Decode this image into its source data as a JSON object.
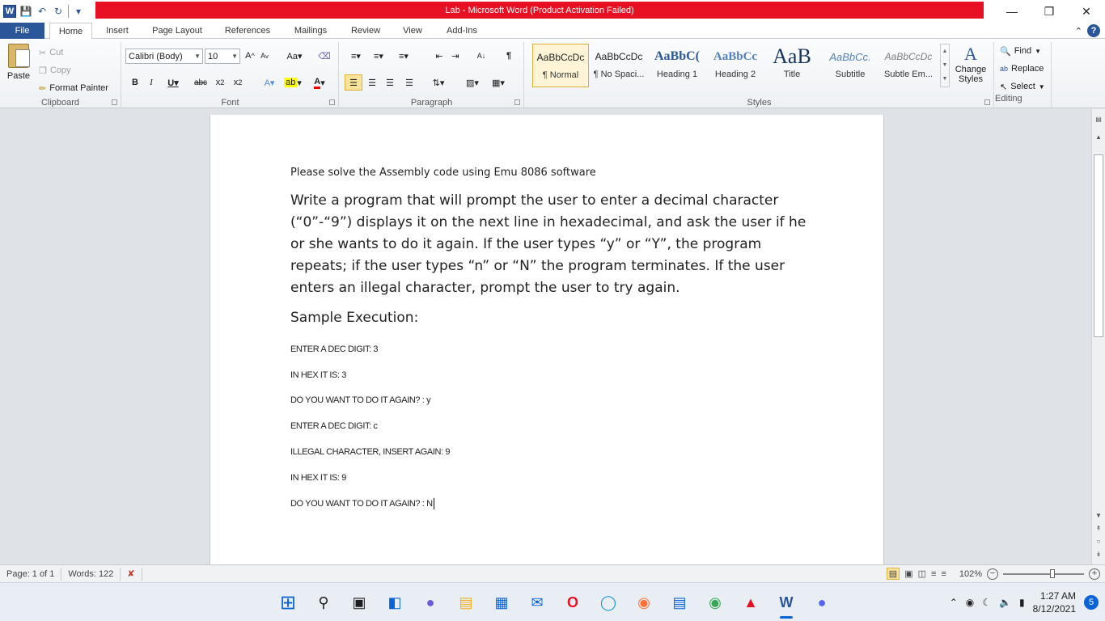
{
  "window": {
    "title": "Lab  -  Microsoft Word (Product Activation Failed)",
    "min_icon": "minimize-icon",
    "max_icon": "restore-icon",
    "close_icon": "close-icon"
  },
  "qat": {
    "logo": "W"
  },
  "tabs": [
    "File",
    "Home",
    "Insert",
    "Page Layout",
    "References",
    "Mailings",
    "Review",
    "View",
    "Add-Ins"
  ],
  "clipboard": {
    "paste": "Paste",
    "cut": "Cut",
    "copy": "Copy",
    "format_painter": "Format Painter",
    "group_label": "Clipboard"
  },
  "font": {
    "font_name": "Calibri (Body)",
    "font_size": "10",
    "group_label": "Font"
  },
  "paragraph": {
    "group_label": "Paragraph"
  },
  "styles": {
    "group_label": "Styles",
    "items": [
      {
        "sample": "AaBbCcDc",
        "name": "¶ Normal"
      },
      {
        "sample": "AaBbCcDc",
        "name": "¶ No Spaci..."
      },
      {
        "sample": "AaBbC(",
        "name": "Heading 1"
      },
      {
        "sample": "AaBbCc",
        "name": "Heading 2"
      },
      {
        "sample": "AaB",
        "name": "Title"
      },
      {
        "sample": "AaBbCc.",
        "name": "Subtitle"
      },
      {
        "sample": "AaBbCcDc",
        "name": "Subtle Em..."
      }
    ],
    "change_styles": "Change Styles"
  },
  "editing": {
    "find": "Find",
    "replace": "Replace",
    "select": "Select",
    "group_label": "Editing"
  },
  "document": {
    "instruction": "Please solve the Assembly code using Emu 8086 software",
    "problem": "Write a program that will prompt the user to enter a decimal character (“0”-“9”) displays it on the next line in hexadecimal, and ask the user if he or she wants to do it again. If the user types “y” or “Y”, the program repeats; if the user types “n” or “N” the program terminates. If the user enters an illegal character, prompt the user to try again.",
    "sample_heading": "Sample Execution:",
    "lines": [
      "ENTER A DEC DIGIT: 3",
      "IN HEX IT IS: 3",
      "DO YOU WANT TO DO IT AGAIN? : y",
      "ENTER A DEC DIGIT: c",
      "ILLEGAL CHARACTER, INSERT AGAIN: 9",
      "IN HEX IT IS: 9",
      "DO YOU WANT TO DO IT AGAIN? : N"
    ]
  },
  "status": {
    "page": "Page: 1 of 1",
    "words": "Words: 122",
    "zoom": "102%"
  },
  "taskbar": {
    "time": "1:27 AM",
    "date": "8/12/2021",
    "notifications": "5"
  }
}
